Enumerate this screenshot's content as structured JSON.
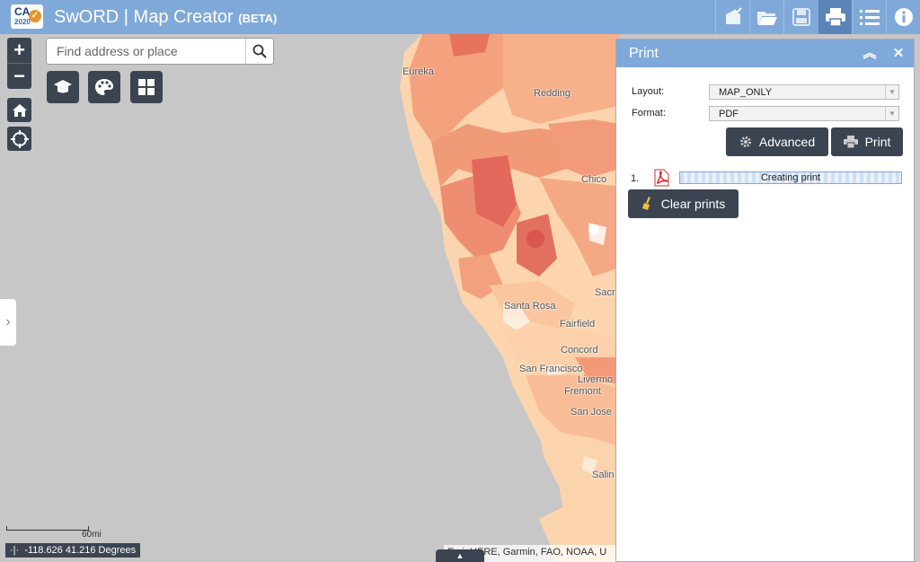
{
  "header": {
    "logo_text": "CA",
    "logo_year": "2020",
    "title": "SwORD | Map Creator",
    "beta": "(BETA)",
    "tools": [
      "basemap-check-icon",
      "folder-open-icon",
      "save-icon",
      "print-icon",
      "list-icon",
      "info-icon"
    ]
  },
  "search": {
    "placeholder": "Find address or place"
  },
  "map": {
    "cities": [
      "Eureka",
      "Redding",
      "Chico",
      "Santa Rosa",
      "Fairfield",
      "Sacr",
      "Concord",
      "San Francisco",
      "Livermo",
      "Fremont",
      "San Jose",
      "Salin"
    ],
    "scale_label": "60mi",
    "coords": "-118.626 41.216 Degrees",
    "attribution": "Esri, HERE, Garmin, FAO, NOAA, U"
  },
  "print_panel": {
    "title": "Print",
    "layout_label": "Layout:",
    "layout_value": "MAP_ONLY",
    "format_label": "Format:",
    "format_value": "PDF",
    "advanced_label": "Advanced",
    "print_label": "Print",
    "job_number": "1.",
    "job_status": "Creating print",
    "clear_label": "Clear prints"
  },
  "colors": {
    "header": "#7fa9d9",
    "control": "#3c4452",
    "map_light": "#fcd7b0",
    "map_mid": "#f4a47f",
    "map_dark": "#e86f5f"
  }
}
